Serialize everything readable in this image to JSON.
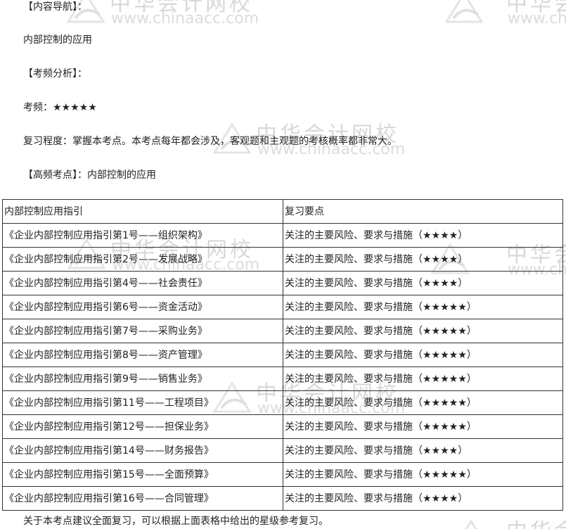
{
  "watermark": {
    "cn": "中华会计网校",
    "url": "www.chinaacc.com",
    "partial_cn": "中华会",
    "partial_url": "www.ch"
  },
  "intro": {
    "nav_heading": "【内容导航】：",
    "nav_text": "内部控制的应用",
    "freq_heading": "【考频分析】：",
    "freq_text": "考频：★★★★★",
    "review_text": "复习程度：掌握本考点。本考点每年都会涉及，客观题和主观题的考核概率都非常大。",
    "hot_heading": "【高频考点】：内部控制的应用"
  },
  "table": {
    "headers": [
      "内部控制应用指引",
      "复习要点"
    ],
    "rows": [
      [
        "《企业内部控制应用指引第1号——组织架构》",
        "关注的主要风险、要求与措施（★★★★）"
      ],
      [
        "《企业内部控制应用指引第2号——发展战略》",
        "关注的主要风险、要求与措施（★★★★）"
      ],
      [
        "《企业内部控制应用指引第4号——社会责任》",
        "关注的主要风险、要求与措施（★★★★）"
      ],
      [
        "《企业内部控制应用指引第6号——资金活动》",
        "关注的主要风险、要求与措施（★★★★★）"
      ],
      [
        "《企业内部控制应用指引第7号——采购业务》",
        "关注的主要风险、要求与措施（★★★★★）"
      ],
      [
        "《企业内部控制应用指引第8号——资产管理》",
        "关注的主要风险、要求与措施（★★★★★）"
      ],
      [
        "《企业内部控制应用指引第9号——销售业务》",
        "关注的主要风险、要求与措施（★★★★★）"
      ],
      [
        "《企业内部控制应用指引第11号——工程项目》",
        "关注的主要风险、要求与措施（★★★★★）"
      ],
      [
        "《企业内部控制应用指引第12号——担保业务》",
        "关注的主要风险、要求与措施（★★★★★）"
      ],
      [
        "《企业内部控制应用指引第14号——财务报告》",
        "关注的主要风险、要求与措施（★★★★）"
      ],
      [
        "《企业内部控制应用指引第15号——全面预算》",
        "关注的主要风险、要求与措施（★★★★★）"
      ],
      [
        "《企业内部控制应用指引第16号——合同管理》",
        "关注的主要风险、要求与措施（★★★★）"
      ]
    ]
  },
  "footer": {
    "note": "关于本考点建议全面复习，可以根据上面表格中给出的星级参考复习。"
  }
}
